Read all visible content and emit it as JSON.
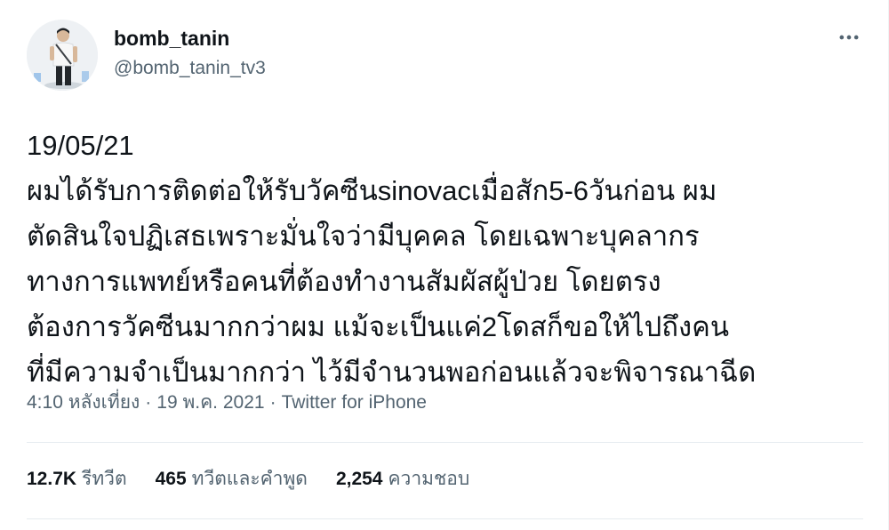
{
  "author": {
    "display_name": "bomb_tanin",
    "handle": "@bomb_tanin_tv3"
  },
  "icons": {
    "more": "more-horizontal-icon",
    "avatar": "profile-photo"
  },
  "tweet": {
    "text": "19/05/21\nผมได้รับการติดต่อให้รับวัคซีนsinovacเมื่อสัก5-6วันก่อน ผม\nตัดสินใจปฏิเสธเพราะมั่นใจว่ามีบุคคล โดยเฉพาะบุคลากร\nทางการแพทย์หรือคนที่ต้องทำงานสัมผัสผู้ป่วย โดยตรง\nต้องการวัคซีนมากกว่าผม แม้จะเป็นแค่2โดสก็ขอให้ไปถึงคน\nที่มีความจำเป็นมากกว่า ไว้มีจำนวนพอก่อนแล้วจะพิจารณาฉีด",
    "time": "4:10 หลังเที่ยง",
    "date": "19 พ.ค. 2021",
    "separator": "·",
    "source": "Twitter for iPhone"
  },
  "stats": {
    "retweets": {
      "count": "12.7K",
      "label": "รีทวีต"
    },
    "quotes": {
      "count": "465",
      "label": "ทวีตและคำพูด"
    },
    "likes": {
      "count": "2,254",
      "label": "ความชอบ"
    }
  },
  "colors": {
    "text": "#0f1419",
    "secondary": "#536471",
    "divider": "#e6ecf0"
  }
}
